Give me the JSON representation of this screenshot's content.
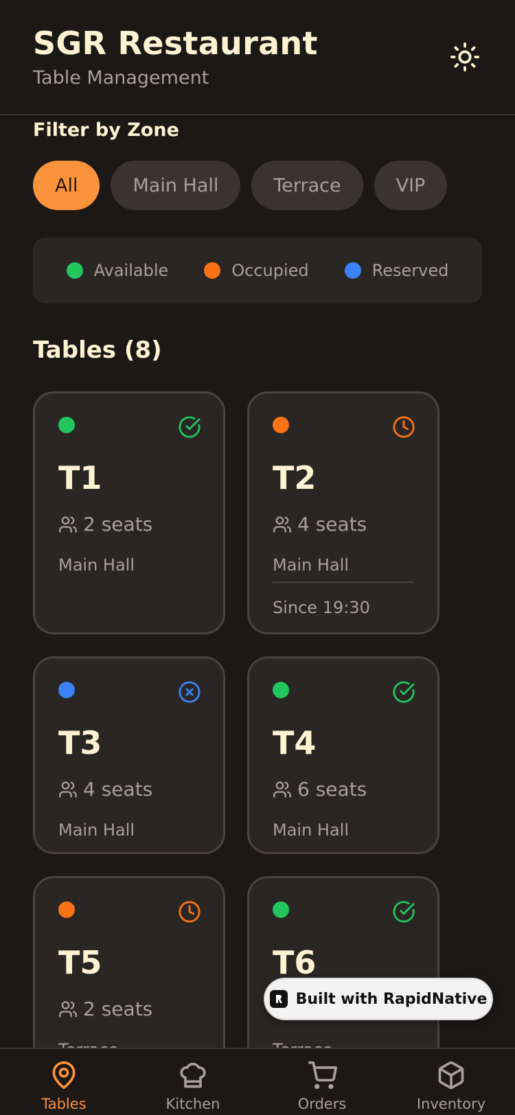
{
  "header": {
    "title": "SGR Restaurant",
    "subtitle": "Table Management",
    "theme_icon": "sun-icon"
  },
  "filter": {
    "label": "Filter by Zone",
    "chips": [
      {
        "label": "All",
        "active": true
      },
      {
        "label": "Main Hall",
        "active": false
      },
      {
        "label": "Terrace",
        "active": false
      },
      {
        "label": "VIP",
        "active": false
      }
    ]
  },
  "legend": [
    {
      "label": "Available",
      "color": "#22c55e"
    },
    {
      "label": "Occupied",
      "color": "#f97316"
    },
    {
      "label": "Reserved",
      "color": "#3b82f6"
    }
  ],
  "tables_title": "Tables (8)",
  "colors": {
    "accent": "#fb923c",
    "available": "#22c55e",
    "occupied": "#f97316",
    "reserved": "#3b82f6"
  },
  "tables": [
    {
      "name": "T1",
      "seats": "2 seats",
      "zone": "Main Hall",
      "status": "available",
      "icon": "check-circle-icon"
    },
    {
      "name": "T2",
      "seats": "4 seats",
      "zone": "Main Hall",
      "status": "occupied",
      "icon": "clock-icon",
      "since": "Since 19:30"
    },
    {
      "name": "T3",
      "seats": "4 seats",
      "zone": "Main Hall",
      "status": "reserved",
      "icon": "x-circle-icon"
    },
    {
      "name": "T4",
      "seats": "6 seats",
      "zone": "Main Hall",
      "status": "available",
      "icon": "check-circle-icon"
    },
    {
      "name": "T5",
      "seats": "2 seats",
      "zone": "Terrace",
      "status": "occupied",
      "icon": "clock-icon"
    },
    {
      "name": "T6",
      "seats": "",
      "zone": "Terrace",
      "status": "available",
      "icon": "check-circle-icon"
    }
  ],
  "badge": {
    "label": "Built with RapidNative"
  },
  "tabs": [
    {
      "label": "Tables",
      "icon": "map-pin-icon",
      "active": true
    },
    {
      "label": "Kitchen",
      "icon": "chef-hat-icon",
      "active": false
    },
    {
      "label": "Orders",
      "icon": "cart-icon",
      "active": false
    },
    {
      "label": "Inventory",
      "icon": "package-icon",
      "active": false
    }
  ]
}
